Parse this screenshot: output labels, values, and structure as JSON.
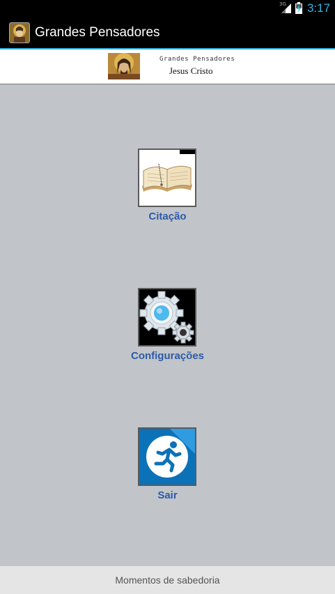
{
  "status_bar": {
    "network": "3G",
    "time": "3:17",
    "accent_color": "#33b5e5"
  },
  "action_bar": {
    "title": "Grandes Pensadores",
    "icon": "portrait-icon"
  },
  "banner": {
    "title": "Grandes Pensadores",
    "name": "Jesus Cristo"
  },
  "menu": {
    "items": [
      {
        "label": "Citação",
        "icon": "book-icon"
      },
      {
        "label": "Configurações",
        "icon": "gears-icon"
      },
      {
        "label": "Sair",
        "icon": "running-man-icon"
      }
    ],
    "label_color": "#2d5aa8"
  },
  "footer": {
    "text": "Momentos de sabedoria"
  }
}
